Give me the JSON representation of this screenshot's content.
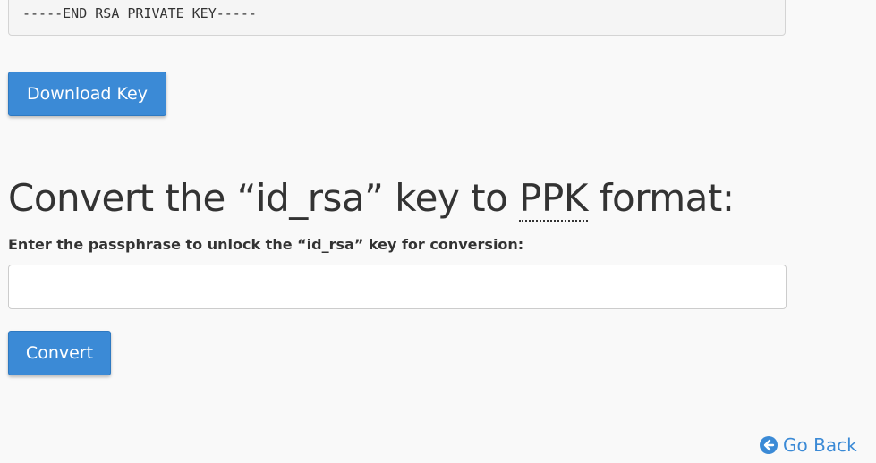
{
  "key_box": {
    "end_line": "-----END RSA PRIVATE KEY-----"
  },
  "buttons": {
    "download_label": "Download Key",
    "convert_label": "Convert"
  },
  "convert_section": {
    "heading_prefix": "Convert the “id_rsa” key to ",
    "heading_abbr": "PPK",
    "heading_suffix": " format:",
    "label_prefix": "Enter the passphrase to unlock the “",
    "label_key": "id_rsa",
    "label_suffix": "” key for conversion:",
    "passphrase_value": "",
    "passphrase_placeholder": ""
  },
  "footer": {
    "go_back_label": "Go Back",
    "go_back_icon": "arrow-circle-left-icon"
  },
  "colors": {
    "accent": "#3b8ad6",
    "text": "#333333",
    "background": "#f9f9f9"
  }
}
